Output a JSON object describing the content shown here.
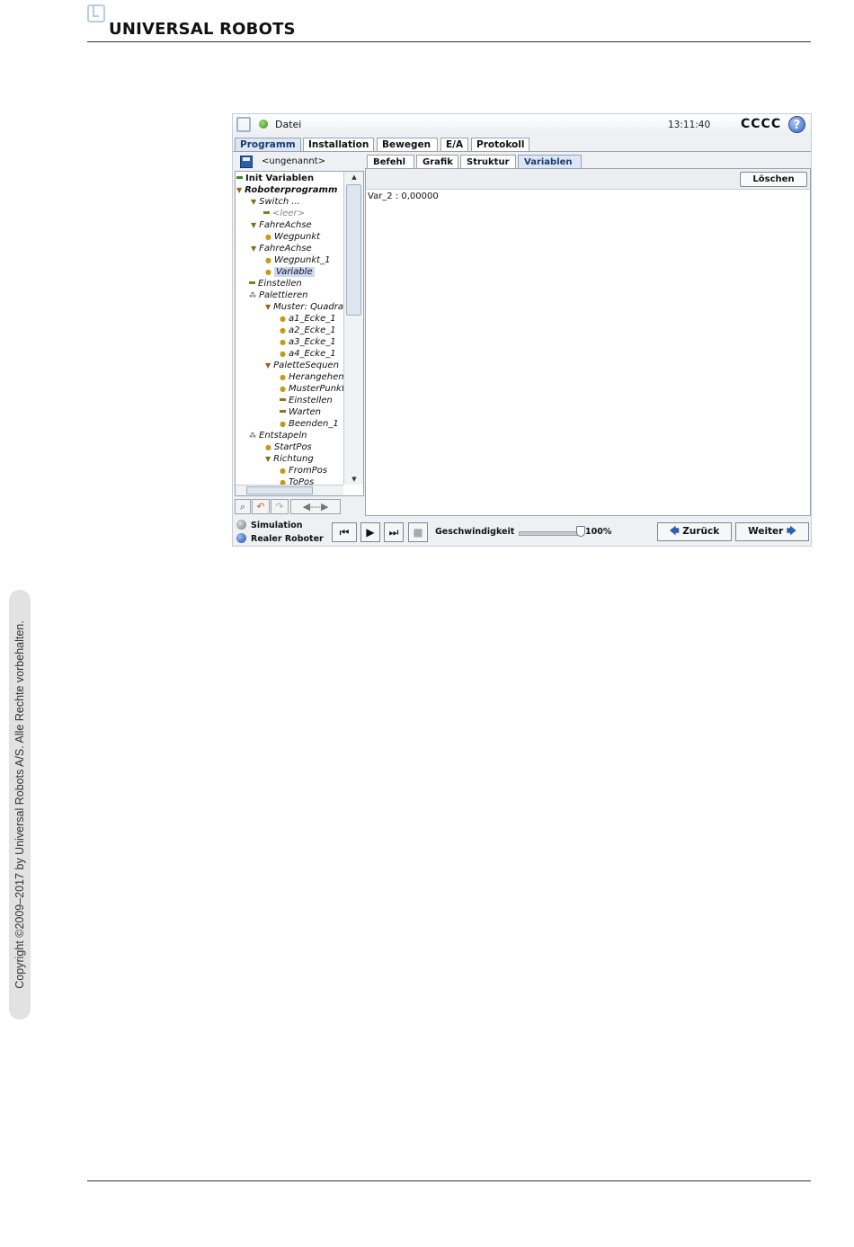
{
  "document": {
    "brand": "UNIVERSAL ROBOTS",
    "copyright": "Copyright ©2009–2017 by Universal Robots A/S. Alle Rechte vorbehalten."
  },
  "titlebar": {
    "menu": "Datei",
    "time": "13:11:40",
    "robot_name": "CCCC",
    "help": "?"
  },
  "main_tabs": [
    "Programm",
    "Installation",
    "Bewegen",
    "E/A",
    "Protokoll"
  ],
  "active_main_tab": "Programm",
  "file": {
    "name": "<ungenannt>"
  },
  "tree": [
    {
      "label": "Init Variablen"
    },
    {
      "label": "Roboterprogramm"
    },
    {
      "label": "Switch ..."
    },
    {
      "label": "<leer>"
    },
    {
      "label": "FahreAchse"
    },
    {
      "label": "Wegpunkt"
    },
    {
      "label": "FahreAchse"
    },
    {
      "label": "Wegpunkt_1"
    },
    {
      "label": "Variable",
      "selected": true
    },
    {
      "label": "Einstellen"
    },
    {
      "label": "Palettieren"
    },
    {
      "label": "Muster: Quadra"
    },
    {
      "label": "a1_Ecke_1"
    },
    {
      "label": "a2_Ecke_1"
    },
    {
      "label": "a3_Ecke_1"
    },
    {
      "label": "a4_Ecke_1"
    },
    {
      "label": "PaletteSequen"
    },
    {
      "label": "Herangehen"
    },
    {
      "label": "MusterPunkt"
    },
    {
      "label": "Einstellen"
    },
    {
      "label": "Warten"
    },
    {
      "label": "Beenden_1"
    },
    {
      "label": "Entstapeln"
    },
    {
      "label": "StartPos"
    },
    {
      "label": "Richtung"
    },
    {
      "label": "FromPos"
    },
    {
      "label": "ToPos"
    }
  ],
  "sub_tabs": [
    "Befehl",
    "Grafik",
    "Struktur",
    "Variablen"
  ],
  "active_sub_tab": "Variablen",
  "variables_panel": {
    "clear_label": "Löschen",
    "lines": [
      "Var_2 : 0,00000"
    ]
  },
  "bottom": {
    "mode_simulation": "Simulation",
    "mode_real": "Realer Roboter",
    "speed_label": "Geschwindigkeit",
    "speed_value": "100%",
    "speed_fraction": 1.0,
    "back_label": "Zurück",
    "next_label": "Weiter"
  },
  "colors": {
    "accent": "#2d5fae",
    "selection": "#c9d9f0",
    "active_tab": "#dbe7f6"
  }
}
